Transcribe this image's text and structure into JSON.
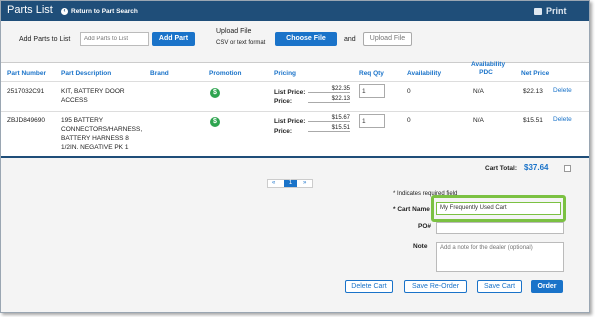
{
  "header": {
    "title": "Parts List",
    "return_label": "Return to Part Search",
    "print_label": "Print"
  },
  "add_bar": {
    "add_label": "Add Parts to List",
    "add_placeholder": "Add Parts to List",
    "add_button": "Add Part",
    "upload_label": "Upload File",
    "upload_hint": "CSV or text format",
    "choose_button": "Choose File",
    "and_label": "and",
    "upload_button": "Upload File"
  },
  "table": {
    "columns": [
      "Part Number",
      "Part Description",
      "Brand",
      "Promotion",
      "Pricing",
      "Req Qty",
      "Availability",
      "Availability PDC",
      "Net Price"
    ],
    "list_price_label": "List Price:",
    "price_label": "Price:",
    "delete_label": "Delete",
    "promo_symbol": "$",
    "rows": [
      {
        "part_number": "2517032C91",
        "description": "KIT, BATTERY DOOR ACCESS",
        "list_price": "$22.35",
        "price": "$22.13",
        "qty": "1",
        "availability": "0",
        "pdc": "N/A",
        "net_price": "$22.13"
      },
      {
        "part_number": "ZBJD849690",
        "description": "195 BATTERY CONNECTORS/HARNESS, BATTERY HARNESS 8 1/2IN. NEGATIVE PK 1",
        "list_price": "$15.67",
        "price": "$15.51",
        "qty": "1",
        "availability": "0",
        "pdc": "N/A",
        "net_price": "$15.51"
      }
    ]
  },
  "cart": {
    "total_label": "Cart Total:",
    "total_value": "$37.64",
    "page_prev": "«",
    "page_current": "1",
    "page_next": "»",
    "required_note": "* Indicates required field",
    "cart_name_label": "* Cart Name",
    "cart_name_value": "My Frequently Used Cart",
    "po_label": "PO#",
    "note_label": "Note",
    "note_placeholder": "Add a note for the dealer (optional)",
    "delete_cart": "Delete Cart",
    "save_reorder": "Save Re-Order",
    "save_cart": "Save Cart",
    "order": "Order"
  }
}
